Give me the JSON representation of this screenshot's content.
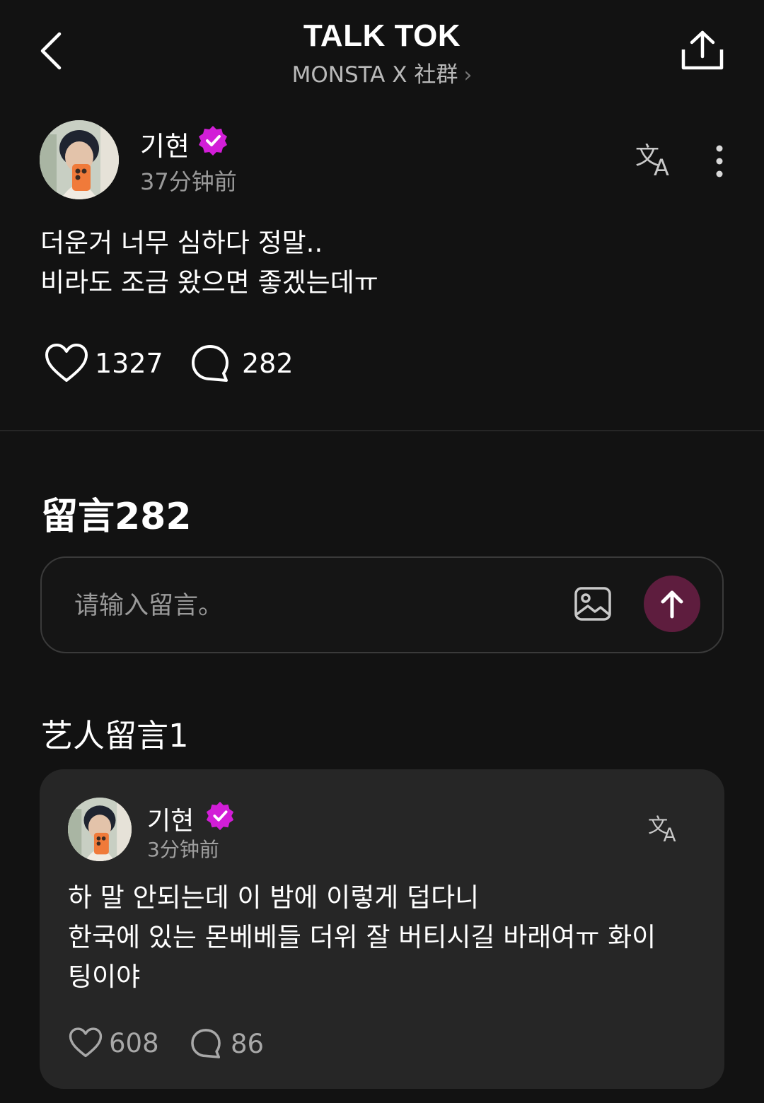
{
  "header": {
    "title": "TALK TOK",
    "community": "MONSTA X 社群",
    "back_icon": "chevron-left-icon",
    "share_icon": "share-upload-icon"
  },
  "post": {
    "author": "기현",
    "verified_icon": "verified-badge-icon",
    "time": "37分钟前",
    "body": "더운거 너무 심하다 정말..\n비라도 조금 왔으면 좋겠는데ㅠ",
    "likes": "1327",
    "comments": "282"
  },
  "comments_section": {
    "title": "留言282",
    "input_placeholder": "请输入留言。"
  },
  "artist_comments": {
    "title": "艺人留言1",
    "items": [
      {
        "author": "기현",
        "time": "3分钟前",
        "body": "하 말 안되는데 이 밤에 이렇게 덥다니\n한국에 있는 몬베베들 더위 잘 버티시길 바래여ㅠ 화이\n팅이야",
        "likes": "608",
        "comments": "86"
      }
    ]
  },
  "colors": {
    "background": "#121212",
    "card": "#262626",
    "verified": "#d21ed7",
    "send_button": "#5e1d3e"
  }
}
